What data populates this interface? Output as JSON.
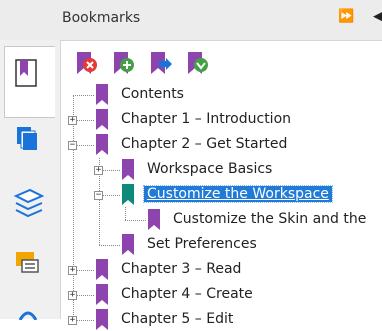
{
  "panel": {
    "title": "Bookmarks",
    "fast_forward_glyph": "⏩",
    "back_glyph": "◀"
  },
  "toolbar": [
    {
      "name": "delete-bookmark",
      "icon": "bookmark-delete-icon"
    },
    {
      "name": "new-bookmark",
      "icon": "bookmark-add-icon"
    },
    {
      "name": "bookmark-goto",
      "icon": "bookmark-arrow-icon"
    },
    {
      "name": "expand-bookmark",
      "icon": "bookmark-expand-icon"
    }
  ],
  "sidebar": [
    {
      "name": "bookmarks",
      "icon": "bookmark-panel-icon",
      "active": true
    },
    {
      "name": "pages",
      "icon": "pages-icon"
    },
    {
      "name": "layers",
      "icon": "layers-icon"
    },
    {
      "name": "comments",
      "icon": "comments-icon"
    },
    {
      "name": "attachments",
      "icon": "attachment-icon"
    }
  ],
  "tree": [
    {
      "label": "Contents",
      "level": 0,
      "expander": "",
      "color": "#8e44ad"
    },
    {
      "label": "Chapter 1 – Introduction",
      "level": 0,
      "expander": "+",
      "color": "#8e44ad"
    },
    {
      "label": "Chapter 2 – Get Started",
      "level": 0,
      "expander": "−",
      "color": "#8e44ad"
    },
    {
      "label": "Workspace Basics",
      "level": 1,
      "expander": "+",
      "color": "#8e44ad"
    },
    {
      "label": "Customize the Workspace",
      "level": 1,
      "expander": "−",
      "color": "#0e8a7a",
      "selected": true
    },
    {
      "label": "Customize the Skin and the",
      "level": 2,
      "expander": "",
      "color": "#8e44ad"
    },
    {
      "label": "Set Preferences",
      "level": 1,
      "expander": "",
      "color": "#8e44ad"
    },
    {
      "label": "Chapter 3 – Read",
      "level": 0,
      "expander": "+",
      "color": "#8e44ad"
    },
    {
      "label": "Chapter 4 – Create",
      "level": 0,
      "expander": "+",
      "color": "#8e44ad"
    },
    {
      "label": "Chapter 5 – Edit",
      "level": 0,
      "expander": "+",
      "color": "#8e44ad"
    }
  ],
  "colors": {
    "bookmark_purple": "#8e44ad",
    "bookmark_teal": "#0e8a7a",
    "selection_blue": "#1f7ad8",
    "icon_blue": "#1a73d9",
    "icon_orange": "#f0a500"
  }
}
